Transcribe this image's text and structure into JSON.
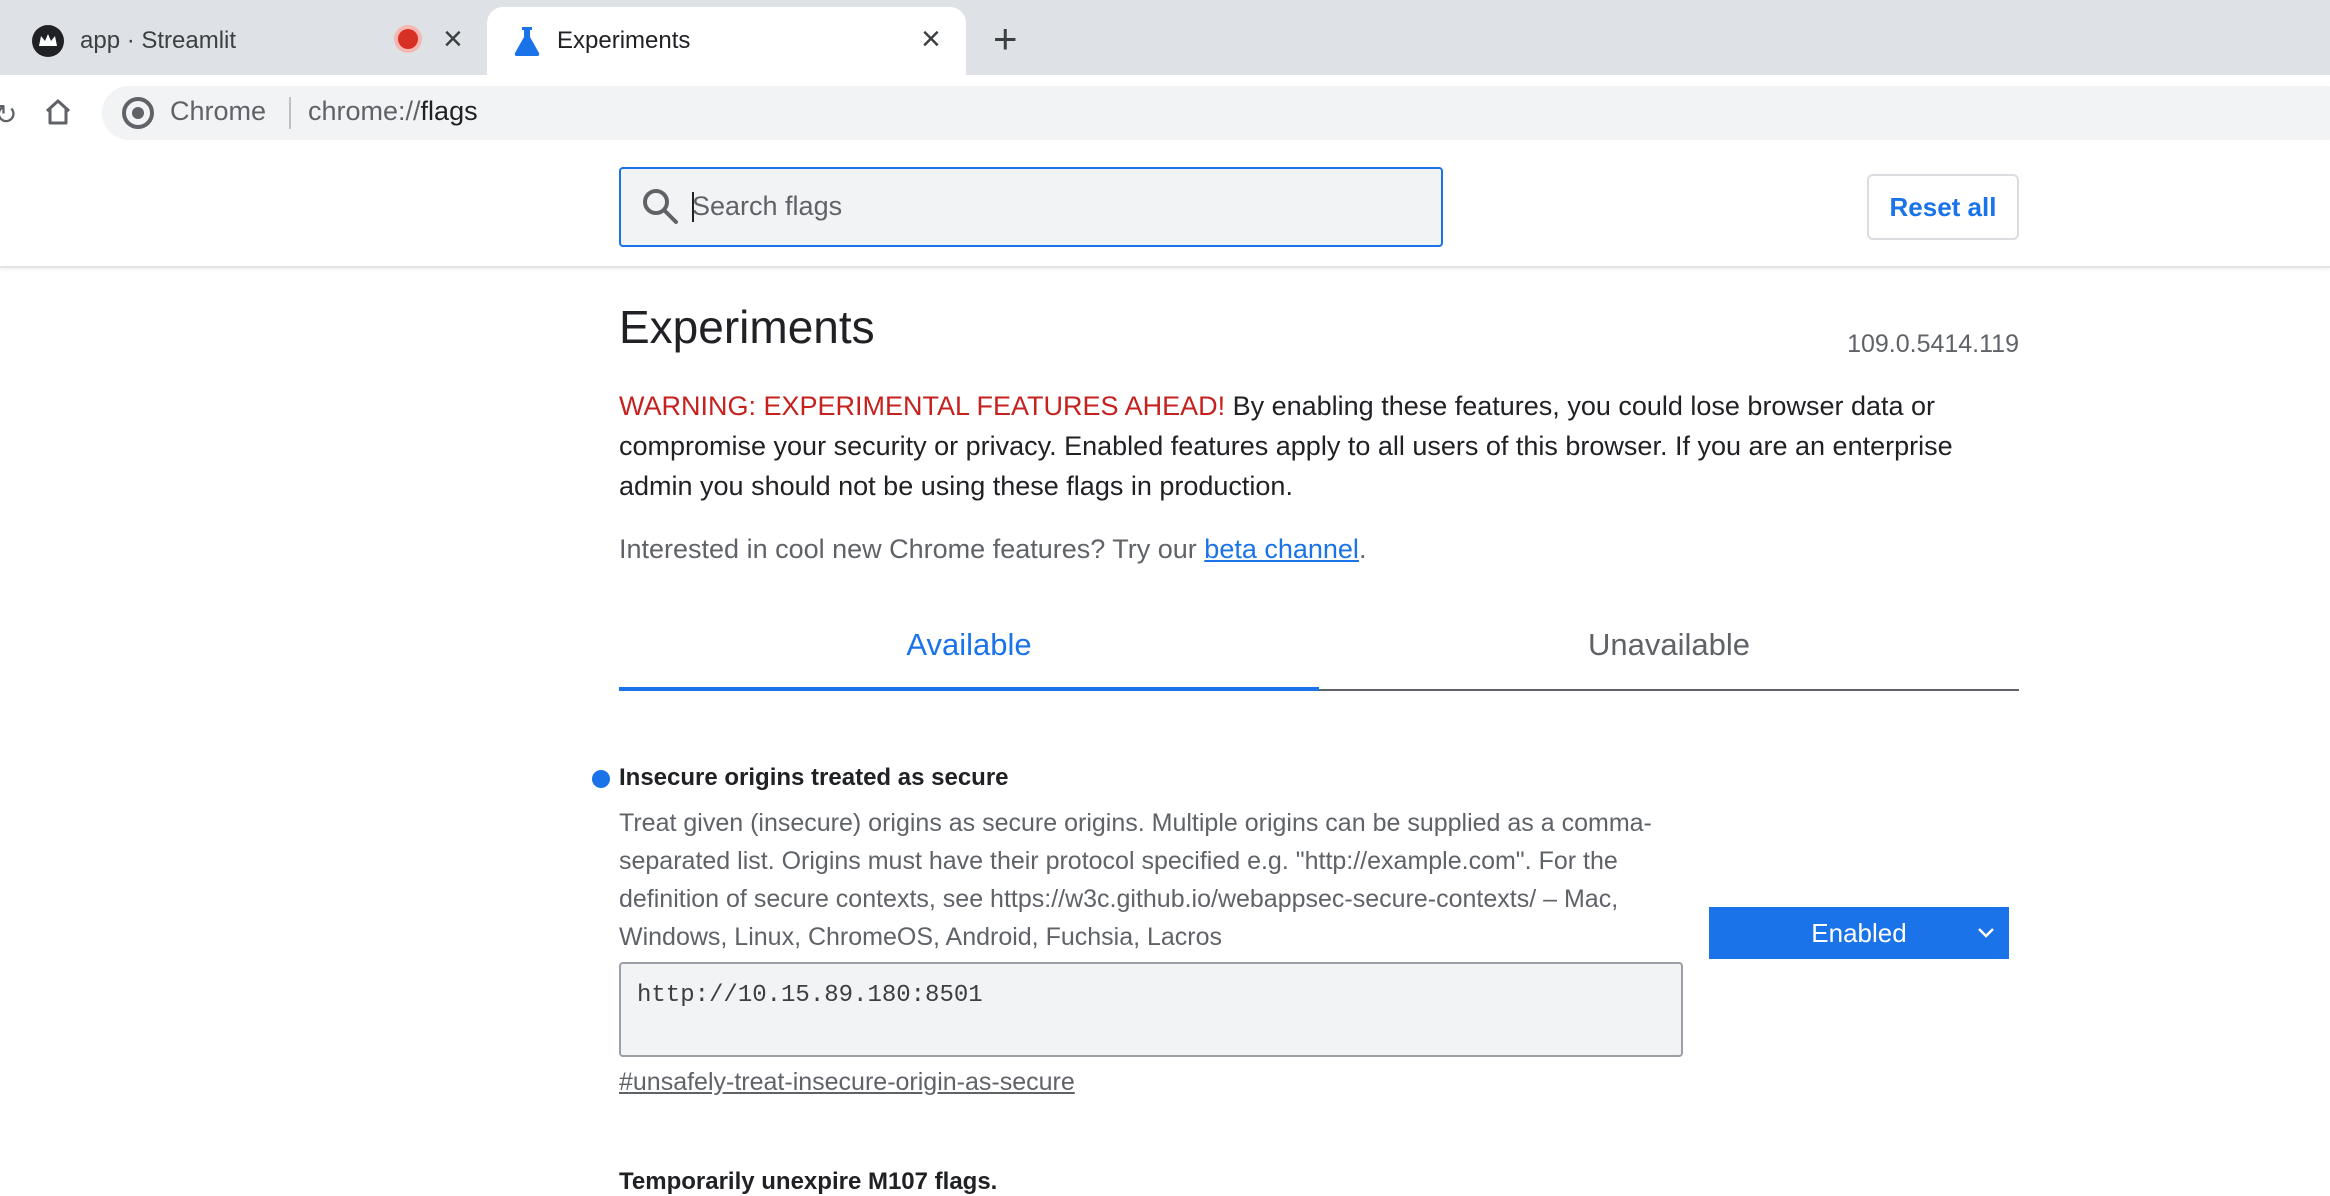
{
  "browser": {
    "tabs": [
      {
        "title": "app · Streamlit",
        "active": false,
        "recording": true
      },
      {
        "title": "Experiments",
        "active": true
      }
    ],
    "omnibox": {
      "chip": "Chrome",
      "url_prefix": "chrome://",
      "url_path": "flags"
    }
  },
  "flags_header": {
    "search_placeholder": "Search flags",
    "reset_label": "Reset all"
  },
  "page": {
    "title": "Experiments",
    "version": "109.0.5414.119",
    "warning_label": "WARNING: EXPERIMENTAL FEATURES AHEAD!",
    "warning_text": " By enabling these features, you could lose browser data or compromise your security or privacy. Enabled features apply to all users of this browser. If you are an enterprise admin you should not be using these flags in production.",
    "interest_text": "Interested in cool new Chrome features? Try our ",
    "interest_link": "beta channel",
    "interest_end": ".",
    "tabs": [
      "Available",
      "Unavailable"
    ]
  },
  "experiments": [
    {
      "title": "Insecure origins treated as secure",
      "description": "Treat given (insecure) origins as secure origins. Multiple origins can be supplied as a comma-separated list. Origins must have their protocol specified e.g. \"http://example.com\". For the definition of secure contexts, see https://w3c.github.io/webappsec-secure-contexts/ – Mac, Windows, Linux, ChromeOS, Android, Fuchsia, Lacros",
      "value": "http://10.15.89.180:8501",
      "state": "Enabled",
      "link": "#unsafely-treat-insecure-origin-as-secure"
    },
    {
      "title": "Temporarily unexpire M107 flags."
    }
  ],
  "colors": {
    "accent": "#1a73e8",
    "warning": "#c5221f",
    "tabstrip": "#dee1e6"
  }
}
